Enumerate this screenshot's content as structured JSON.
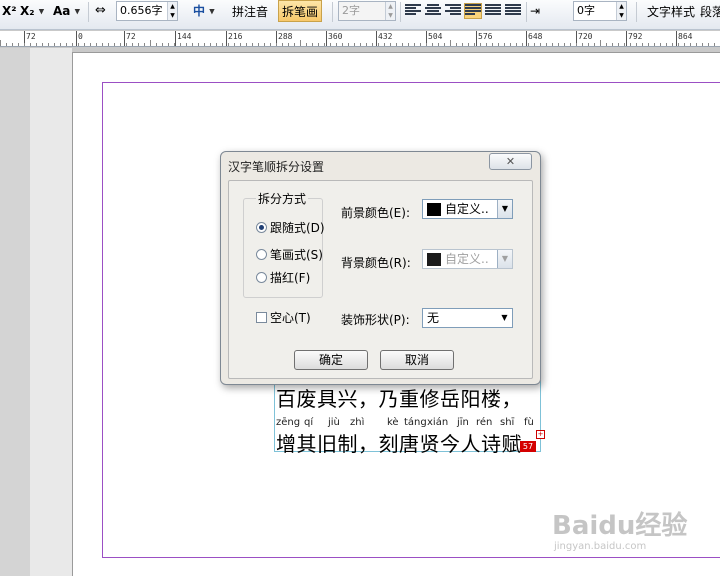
{
  "toolbar": {
    "superscript": "X²",
    "subscript": "X₂",
    "font_case": "Aa",
    "char_spacing_value": "0.656字",
    "center_mark": "中",
    "pinyin_button": "拼注音",
    "stroke_button": "拆笔画",
    "indent_value": "2字",
    "line_indent_value": "0字",
    "text_style_button": "文字样式",
    "paragraph_button": "段落"
  },
  "ruler": {
    "labels": [
      "72",
      "0",
      "72",
      "144",
      "216",
      "288",
      "360",
      "432",
      "504",
      "576",
      "648",
      "720",
      "792",
      "864"
    ]
  },
  "document": {
    "line1": "百废具兴，乃重修岳阳楼，",
    "pinyin": [
      "zēng",
      "qí",
      "jiù",
      "zhì",
      "kè",
      "táng",
      "xián",
      "jīn",
      "rén",
      "shī",
      "fù"
    ],
    "line2": "增其旧制，刻唐贤今人诗赋",
    "overflow_badge": "57"
  },
  "dialog": {
    "title": "汉字笔顺拆分设置",
    "close_symbol": "✕",
    "group_title": "拆分方式",
    "options": [
      {
        "label": "跟随式(D)",
        "selected": true
      },
      {
        "label": "笔画式(S)",
        "selected": false
      },
      {
        "label": "描红(F)",
        "selected": false
      }
    ],
    "foreground_label": "前景颜色(E):",
    "foreground_value": "自定义..",
    "background_label": "背景颜色(R):",
    "background_value": "自定义..",
    "hollow_label": "空心(T)",
    "decoration_label": "装饰形状(P):",
    "decoration_value": "无",
    "ok_button": "确定",
    "cancel_button": "取消"
  },
  "watermark": {
    "main": "Baidu经验",
    "sub": "jingyan.baidu.com"
  }
}
